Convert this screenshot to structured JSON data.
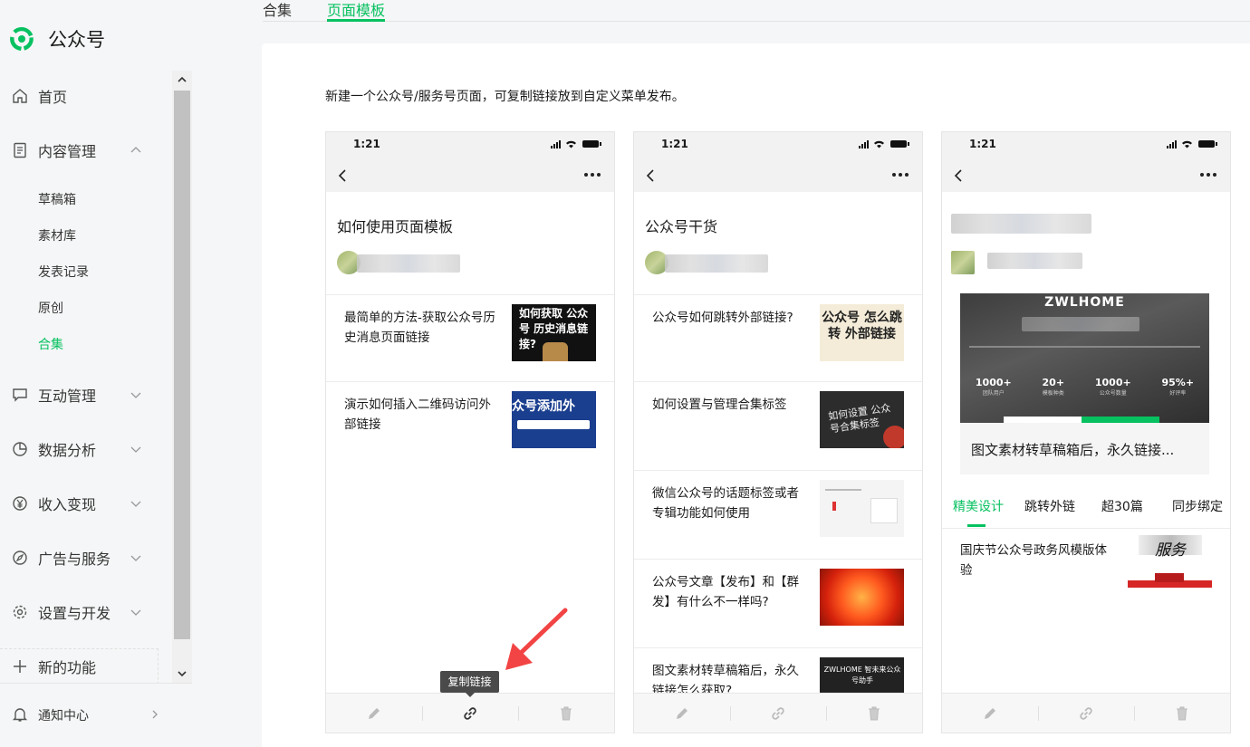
{
  "brand": {
    "name": "公众号",
    "accent": "#07c160"
  },
  "sidebar": {
    "items": [
      {
        "label": "首页",
        "icon": "home-icon"
      },
      {
        "label": "内容管理",
        "icon": "document-icon"
      },
      {
        "label": "互动管理",
        "icon": "chat-icon"
      },
      {
        "label": "数据分析",
        "icon": "pie-chart-icon"
      },
      {
        "label": "收入变现",
        "icon": "yen-icon"
      },
      {
        "label": "广告与服务",
        "icon": "compass-icon"
      },
      {
        "label": "设置与开发",
        "icon": "gear-icon"
      }
    ],
    "content_sub": [
      "草稿箱",
      "素材库",
      "发表记录",
      "原创",
      "合集"
    ],
    "active_sub": "合集",
    "new_feature": "新的功能",
    "notice": "通知中心"
  },
  "tabs": [
    "合集",
    "页面模板"
  ],
  "active_tab": "页面模板",
  "intro": "新建一个公众号/服务号页面，可复制链接放到自定义菜单发布。",
  "phone_time": "1:21",
  "cards": [
    {
      "title": "如何使用页面模板",
      "articles": [
        {
          "title": "最简单的方法-获取公众号历史消息页面链接",
          "thumb_text": "如何获取 公众号 历史消息链接?"
        },
        {
          "title": "演示如何插入二维码访问外部链接",
          "thumb_text": "众号添加外"
        }
      ]
    },
    {
      "title": "公众号干货",
      "articles": [
        {
          "title": "公众号如何跳转外部链接?",
          "thumb_text": "公众号 怎么跳转 外部链接"
        },
        {
          "title": "如何设置与管理合集标签",
          "thumb_text": "如何设置 公众号合集标签"
        },
        {
          "title": "微信公众号的话题标签或者专辑功能如何使用",
          "thumb_text": ""
        },
        {
          "title": "公众号文章【发布】和【群发】有什么不一样吗?",
          "thumb_text": ""
        },
        {
          "title": "图文素材转草稿箱后，永久链接怎么获取?",
          "thumb_text": "ZWLHOME 智未来公众号助手"
        }
      ]
    },
    {
      "banner": {
        "logo": "ZWLHOME",
        "stats": [
          {
            "value": "1000+",
            "label": "团队用户"
          },
          {
            "value": "20+",
            "label": "模板种类"
          },
          {
            "value": "1000+",
            "label": "公众号数量"
          },
          {
            "value": "95%+",
            "label": "好评率"
          }
        ],
        "title": "图文素材转草稿箱后，永久链接..."
      },
      "tabs": [
        "精美设计",
        "跳转外链",
        "超30篇",
        "同步绑定"
      ],
      "articles": [
        {
          "title": "国庆节公众号政务风模版体验",
          "thumb_text": "服务"
        }
      ]
    }
  ],
  "tooltip": "复制链接",
  "footer_icons": [
    "pencil-icon",
    "link-icon",
    "trash-icon"
  ]
}
